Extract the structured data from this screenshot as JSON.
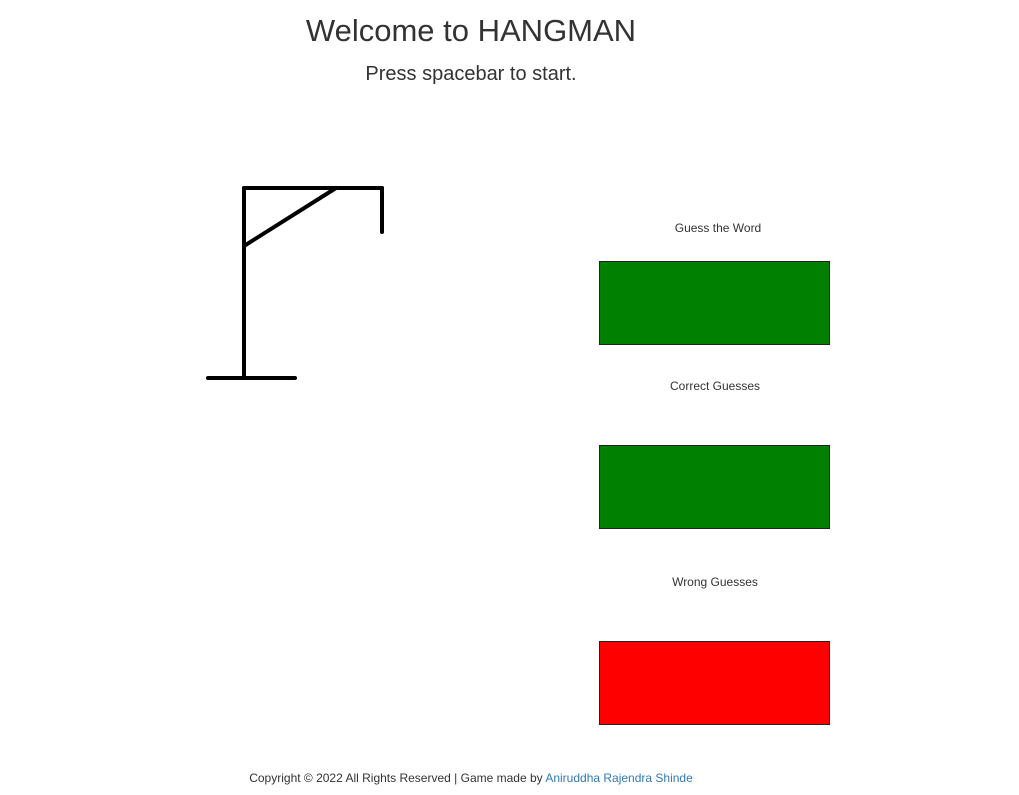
{
  "header": {
    "title": "Welcome to HANGMAN",
    "instruction": "Press spacebar to start."
  },
  "panels": {
    "guess_word": {
      "label": "Guess the Word",
      "value": "",
      "color": "#008000"
    },
    "correct_guesses": {
      "label": "Correct Guesses",
      "value": "",
      "color": "#008000"
    },
    "wrong_guesses": {
      "label": "Wrong Guesses",
      "value": "",
      "color": "#ff0000"
    }
  },
  "footer": {
    "text": "Copyright © 2022 All Rights Reserved | Game made by",
    "author_link": "Aniruddha Rajendra Shinde",
    "link_color": "#337ab7"
  },
  "gallows": {
    "stroke_color": "#000000"
  }
}
